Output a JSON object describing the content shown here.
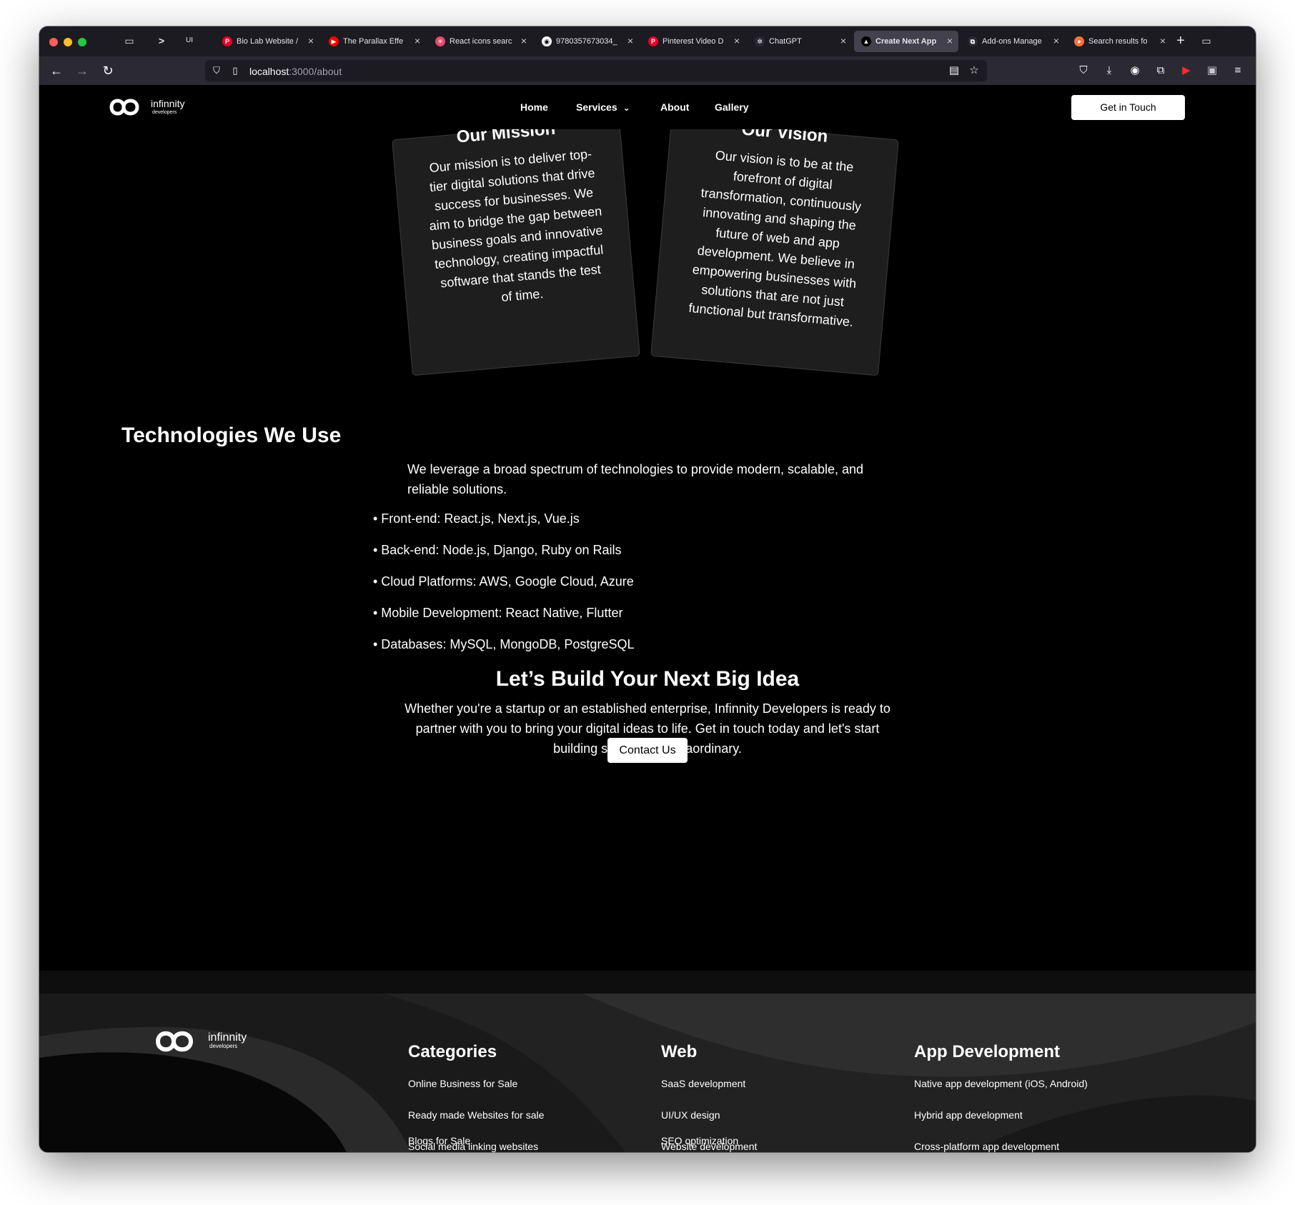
{
  "browser": {
    "tabs": [
      {
        "title": "Bio Lab Website / ",
        "favicon": "pinterest-icon",
        "color": "#e60023",
        "glyph": "P"
      },
      {
        "title": "The Parallax Effe",
        "favicon": "youtube-icon",
        "color": "#ff0000",
        "glyph": "▶"
      },
      {
        "title": "React icons searc",
        "favicon": "react-icon",
        "color": "#e24a6b",
        "glyph": "✳"
      },
      {
        "title": "9780357673034_",
        "favicon": "github-icon",
        "color": "#ffffff",
        "glyph": "◉"
      },
      {
        "title": "Pinterest Video D",
        "favicon": "pinterest-icon",
        "color": "#e60023",
        "glyph": "P"
      },
      {
        "title": "ChatGPT",
        "favicon": "chatgpt-icon",
        "color": "#2b2a33",
        "glyph": "✲"
      },
      {
        "title": "Create Next App",
        "favicon": "nextjs-icon",
        "color": "#000000",
        "glyph": "▲"
      },
      {
        "title": "Add-ons Manage",
        "favicon": "puzzle-icon",
        "color": "#2b2a33",
        "glyph": "⧉"
      },
      {
        "title": "Search results fo",
        "favicon": "firefox-icon",
        "color": "#ff7139",
        "glyph": "●"
      }
    ],
    "url_host": "localhost",
    "url_path": ":3000/about"
  },
  "header": {
    "logo_text": "infinnity",
    "logo_subtext": "developers",
    "nav": {
      "home": "Home",
      "services": "Services",
      "about": "About",
      "gallery": "Gallery"
    },
    "cta": "Get in Touch"
  },
  "mission": {
    "title": "Our Mission",
    "text": "Our mission is to deliver top-tier digital solutions that drive success for businesses. We aim to bridge the gap between business goals and innovative technology, creating impactful software that stands the test of time."
  },
  "vision": {
    "title": "Our Vision",
    "text": "Our vision is to be at the forefront of digital transformation, continuously innovating and shaping the future of web and app development. We believe in empowering businesses with solutions that are not just functional but transformative."
  },
  "technologies": {
    "title": "Technologies We Use",
    "intro": "We leverage a broad spectrum of technologies to provide modern, scalable, and reliable solutions.",
    "items": [
      "• Front-end: React.js, Next.js, Vue.js",
      "• Back-end: Node.js, Django, Ruby on Rails",
      "• Cloud Platforms: AWS, Google Cloud, Azure",
      "• Mobile Development: React Native, Flutter",
      "• Databases: MySQL, MongoDB, PostgreSQL"
    ]
  },
  "cta": {
    "title": "Let’s Build Your Next Big Idea",
    "text": "Whether you're a startup or an established enterprise, Infinnity Developers is ready to partner with you to bring your digital ideas to life. Get in touch today and let's start building something extraordinary.",
    "button": "Contact Us"
  },
  "footer": {
    "categories": {
      "title": "Categories",
      "links": [
        "Online Business for Sale",
        "Ready made Websites for sale",
        "Social media linking websites",
        "Blogs for Sale"
      ]
    },
    "web": {
      "title": "Web",
      "links": [
        "SaaS development",
        "UI/UX design",
        "Website development",
        "SEO optimization"
      ]
    },
    "app": {
      "title": "App Development",
      "links": [
        "Native app development (iOS, Android)",
        "Hybrid app development",
        "Cross-platform app development"
      ]
    }
  }
}
